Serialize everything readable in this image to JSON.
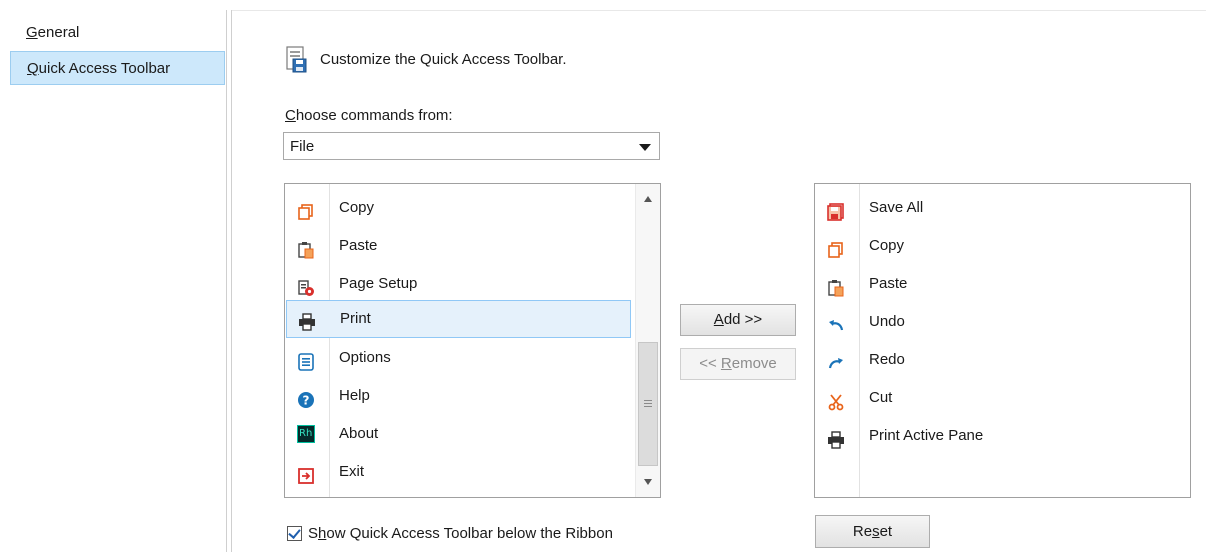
{
  "nav": {
    "items": [
      {
        "label_pre": "",
        "label_u": "G",
        "label_post": "eneral"
      },
      {
        "label_pre": "",
        "label_u": "Q",
        "label_post": "uick Access Toolbar"
      }
    ]
  },
  "header": {
    "title": "Customize the Quick Access Toolbar."
  },
  "commands": {
    "label_u": "C",
    "label_post": "hoose commands from:",
    "selected": "File"
  },
  "available": {
    "items": [
      {
        "label": "Copy",
        "icon": "copy-icon"
      },
      {
        "label": "Paste",
        "icon": "paste-icon"
      },
      {
        "label": "Page Setup",
        "icon": "page-setup-icon"
      },
      {
        "label": "Print",
        "icon": "print-icon"
      },
      {
        "label": "Options",
        "icon": "options-icon"
      },
      {
        "label": "Help",
        "icon": "help-icon"
      },
      {
        "label": "About",
        "icon": "about-icon"
      },
      {
        "label": "Exit",
        "icon": "exit-icon"
      }
    ],
    "about_icon_text": "Rh"
  },
  "toolbar": {
    "items": [
      {
        "label": "Save All",
        "icon": "save-all-icon"
      },
      {
        "label": "Copy",
        "icon": "copy-icon"
      },
      {
        "label": "Paste",
        "icon": "paste-icon"
      },
      {
        "label": "Undo",
        "icon": "undo-icon"
      },
      {
        "label": "Redo",
        "icon": "redo-icon"
      },
      {
        "label": "Cut",
        "icon": "cut-icon"
      },
      {
        "label": "Print Active Pane",
        "icon": "print-icon"
      }
    ]
  },
  "buttons": {
    "add": {
      "u": "A",
      "post": "dd >>"
    },
    "remove": {
      "pre": "<< ",
      "u": "R",
      "post": "emove"
    },
    "reset": {
      "pre": "Re",
      "u": "s",
      "post": "et"
    }
  },
  "checkbox": {
    "checked": true,
    "label_pre": "S",
    "label_u": "h",
    "label_post": "ow Quick Access Toolbar below the Ribbon"
  },
  "colors": {
    "accent": "#0078d7",
    "orange": "#e8641b",
    "red": "#d9302c",
    "nav_selected": "#cde8fb"
  }
}
